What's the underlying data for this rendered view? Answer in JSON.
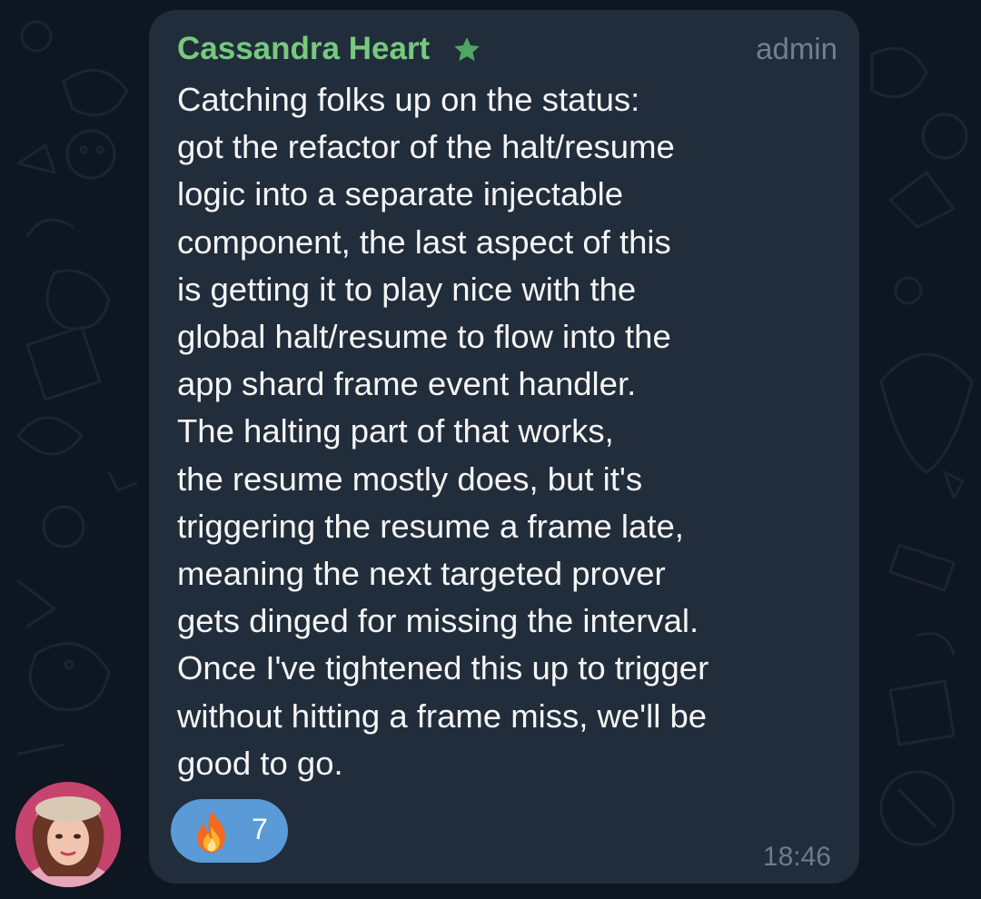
{
  "message": {
    "sender": "Cassandra Heart",
    "sender_badge_icon": "star-icon",
    "role": "admin",
    "text": "Catching folks up on the status:\ngot the refactor of the halt/resume\nlogic into a separate injectable\ncomponent, the last aspect of this\nis getting it to play nice with the\nglobal halt/resume to flow into the\napp shard frame event handler.\nThe halting part of that works,\nthe resume mostly does, but it's\ntriggering the resume a frame late,\nmeaning the next targeted prover\ngets dinged for missing the interval.\nOnce I've tightened this up to trigger\nwithout hitting a frame miss, we'll be\ngood to go.",
    "time": "18:46",
    "reaction": {
      "icon": "fire-icon",
      "count": "7"
    }
  },
  "colors": {
    "background": "#0e1621",
    "bubble": "#212d3b",
    "sender_name": "#77c97e",
    "reaction_pill": "#5a9ad6",
    "meta_text": "#72808e"
  }
}
